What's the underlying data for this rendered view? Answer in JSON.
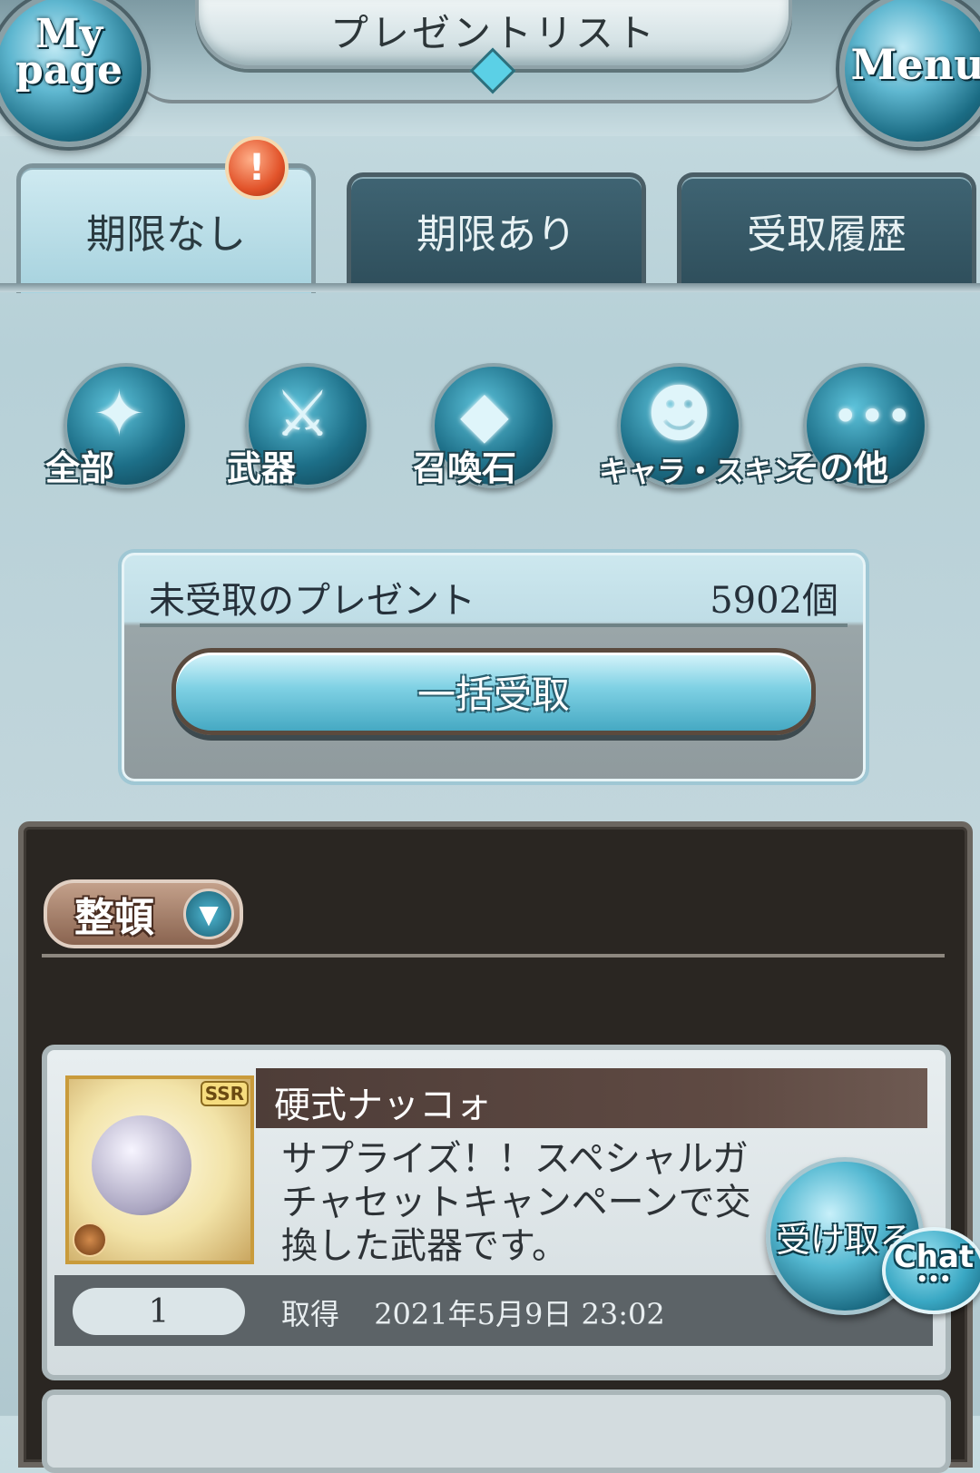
{
  "header": {
    "title": "プレゼントリスト",
    "mypage_label": "My page",
    "menu_label": "Menu"
  },
  "tabs": [
    {
      "label": "期限なし",
      "active": true,
      "alert": "!"
    },
    {
      "label": "期限あり",
      "active": false
    },
    {
      "label": "受取履歴",
      "active": false
    }
  ],
  "categories": [
    {
      "label": "全部",
      "icon": "all-items-icon"
    },
    {
      "label": "武器",
      "icon": "sword-icon"
    },
    {
      "label": "召喚石",
      "icon": "crystal-icon"
    },
    {
      "label": "キャラ・スキン",
      "icon": "character-silhouette-icon"
    },
    {
      "label": "その他",
      "icon": "ellipsis-icon"
    }
  ],
  "summary": {
    "label": "未受取のプレゼント",
    "count": "5902個",
    "claim_all_label": "一括受取"
  },
  "list": {
    "sort_label": "整頓",
    "items": [
      {
        "name": "硬式ナッコォ",
        "rarity": "SSR",
        "description": "サプライズ！！スペシャルガチャセットキャンペーンで交換した武器です。",
        "quantity": "1",
        "acquired_label": "取得",
        "acquired_date": "2021年5月9日 23:02",
        "receive_label": "受け取る"
      }
    ]
  },
  "chat": {
    "label": "Chat",
    "dots": "•••"
  },
  "colors": {
    "accent": "#46a9c3",
    "panel_dark": "#2a2622",
    "alert": "#e2532a"
  }
}
